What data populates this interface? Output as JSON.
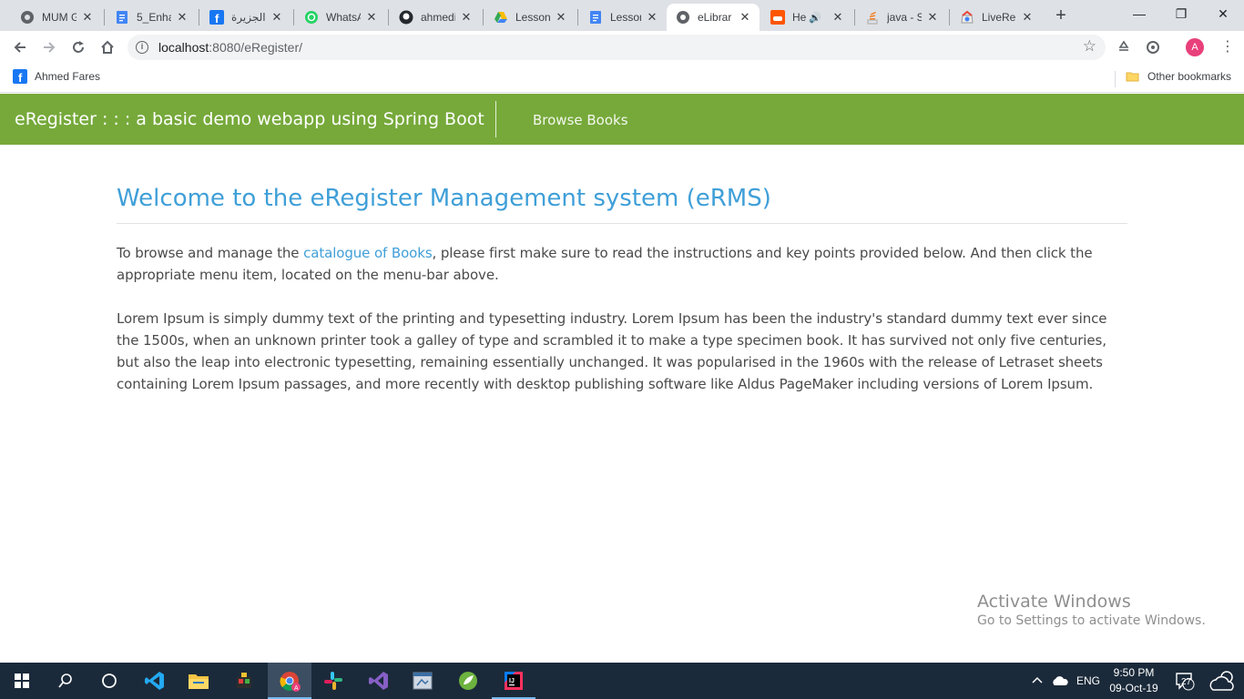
{
  "browser": {
    "tabs": [
      {
        "title": "MUM G",
        "icon": "chrome-globe-icon"
      },
      {
        "title": "5_Enha",
        "icon": "google-docs-icon"
      },
      {
        "title": "الجزيرة",
        "icon": "facebook-icon"
      },
      {
        "title": "WhatsA",
        "icon": "whatsapp-icon"
      },
      {
        "title": "ahmedi",
        "icon": "github-icon"
      },
      {
        "title": "Lesson",
        "icon": "google-drive-icon"
      },
      {
        "title": "Lesson",
        "icon": "google-docs-icon"
      },
      {
        "title": "eLibrar",
        "icon": "chrome-globe-icon",
        "active": true
      },
      {
        "title": "He",
        "icon": "soundcloud-icon",
        "audio": true
      },
      {
        "title": "java - S",
        "icon": "stackoverflow-icon"
      },
      {
        "title": "LiveRel",
        "icon": "chrome-webstore-icon"
      }
    ],
    "new_tab_label": "+",
    "window": {
      "minimize": "—",
      "restore": "❐",
      "close": "✕"
    },
    "address": {
      "host": "localhost",
      "path": ":8080/eRegister/"
    },
    "profile_initial": "A",
    "bookmarks": [
      {
        "label": "Ahmed Fares",
        "icon": "facebook-icon"
      }
    ],
    "other_bookmarks_label": "Other bookmarks"
  },
  "page": {
    "brand": "eRegister : : : a basic demo webapp using Spring Boot",
    "menu_item": "Browse Books",
    "heading": "Welcome to the eRegister Management system (eRMS)",
    "intro_before": "To browse and manage the ",
    "intro_link": "catalogue of Books",
    "intro_after": ", please first make sure to read the instructions and key points provided below. And then click the appropriate menu item, located on the menu-bar above.",
    "lorem": "Lorem Ipsum is simply dummy text of the printing and typesetting industry. Lorem Ipsum has been the industry's standard dummy text ever since the 1500s, when an unknown printer took a galley of type and scrambled it to make a type specimen book. It has survived not only five centuries, but also the leap into electronic typesetting, remaining essentially unchanged. It was popularised in the 1960s with the release of Letraset sheets containing Lorem Ipsum passages, and more recently with desktop publishing software like Aldus PageMaker including versions of Lorem Ipsum."
  },
  "watermark": {
    "title": "Activate Windows",
    "subtitle": "Go to Settings to activate Windows."
  },
  "taskbar": {
    "apps": [
      "windows-start-icon",
      "search-icon",
      "task-view-icon",
      "vscode-icon",
      "file-explorer-icon",
      "app-icon",
      "chrome-icon",
      "slack-icon",
      "visual-studio-icon",
      "app-window-icon",
      "spring-tool-suite-icon",
      "intellij-icon"
    ],
    "language": "ENG",
    "time": "9:50 PM",
    "date": "09-Oct-19",
    "notifications": "27"
  },
  "colors": {
    "appbar": "#76a93a",
    "heading": "#3f9fd8",
    "link": "#3f9fd8",
    "taskbar": "#1b2a3a"
  }
}
